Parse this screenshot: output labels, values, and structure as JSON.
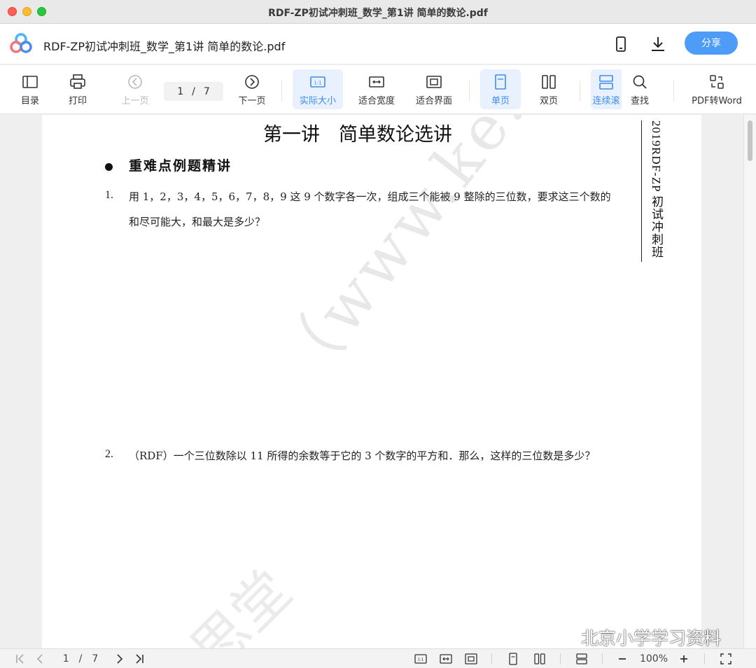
{
  "window": {
    "title": "RDF-ZP初试冲刺班_数学_第1讲 简单的数论.pdf"
  },
  "appbar": {
    "doc_name": "RDF-ZP初试冲刺班_数学_第1讲 简单的数论.pdf",
    "share_label": "分享"
  },
  "toolbar": {
    "toc": "目录",
    "print": "打印",
    "prev": "上一页",
    "current_page": "1",
    "page_sep": "/",
    "total_pages": "7",
    "next": "下一页",
    "actual_size": "实际大小",
    "fit_width": "适合宽度",
    "fit_page": "适合界面",
    "single": "单页",
    "double": "双页",
    "continuous": "连续滚",
    "find": "查找",
    "to_word": "PDF转Word"
  },
  "document": {
    "title": "第一讲　简单数论选讲",
    "section": "重难点例题精讲",
    "q1_num": "1.",
    "q1_line1": "用 1，2，3，4，5，6，7，8，9 这 9 个数字各一次，组成三个能被 9 整除的三位数，要求这三个数的",
    "q1_line2": "和尽可能大，和最大是多少？",
    "q2_num": "2.",
    "q2_text": "（RDF）一个三位数除以 11 所得的余数等于它的 3 个数字的平方和．那么，这样的三位数是多少？",
    "side_label": "2019RDF-ZP 初试冲刺班",
    "watermark": "（www.ke.live）",
    "watermark2": "思堂"
  },
  "statusbar": {
    "current_page": "1",
    "page_sep": "/",
    "total_pages": "7",
    "zoom": "100%"
  },
  "overlay": {
    "wechat_label": "北京小学学习资料"
  },
  "colors": {
    "accent": "#4d9cf7",
    "active_bg": "#e8f1fd"
  }
}
